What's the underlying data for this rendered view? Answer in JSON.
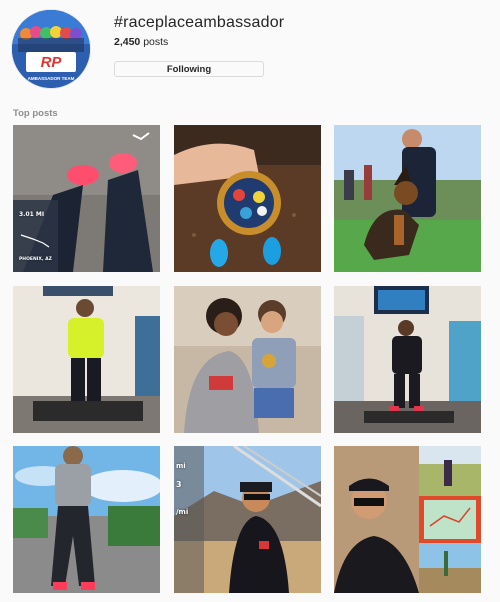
{
  "header": {
    "hashtag": "#raceplaceambassador",
    "posts_count": "2,450",
    "posts_suffix": " posts",
    "follow_button_label": "Following",
    "avatar_icon": "race-place-ambassador-team-logo",
    "avatar_text": {
      "monogram": "RP",
      "subtitle": "AMBASSADOR TEAM"
    }
  },
  "section": {
    "label": "Top posts"
  },
  "posts": [
    {
      "id": "post-1",
      "overlay_text": [
        "3.01 MI",
        "PHOENIX, AZ"
      ]
    },
    {
      "id": "post-2",
      "overlay_text": []
    },
    {
      "id": "post-3",
      "overlay_text": []
    },
    {
      "id": "post-4",
      "overlay_text": []
    },
    {
      "id": "post-5",
      "overlay_text": []
    },
    {
      "id": "post-6",
      "overlay_text": []
    },
    {
      "id": "post-7",
      "overlay_text": []
    },
    {
      "id": "post-8",
      "overlay_text": [
        "mi",
        "3",
        "/mi"
      ]
    },
    {
      "id": "post-9",
      "overlay_text": []
    }
  ],
  "colors": {
    "background": "#fafafa",
    "text": "#262626",
    "muted": "#8e8e8e",
    "border": "#dbdbdb"
  }
}
